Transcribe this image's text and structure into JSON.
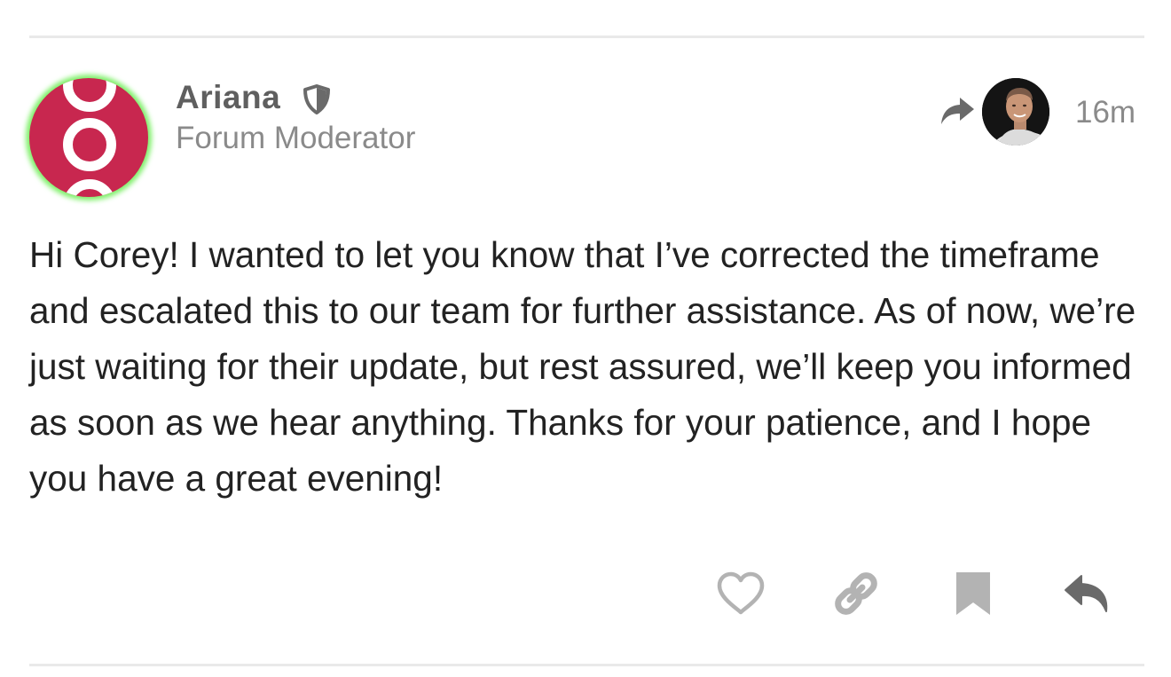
{
  "post": {
    "author": {
      "username": "Ariana",
      "title": "Forum Moderator",
      "avatar_icon": "avatar-rings-icon",
      "avatar_color": "#c8274f",
      "presence_color": "#7ff06a",
      "badge_icon": "shield-icon"
    },
    "reply_to": {
      "icon": "share-arrow-icon",
      "avatar_icon": "user-photo-avatar"
    },
    "time": "16m",
    "body": "Hi Corey! I wanted to let you know that I’ve corrected the timeframe and escalated this to our team for further assistance. As of now, we’re just waiting for their update, but rest assured, we’ll keep you informed as soon as we hear anything. Thanks for your patience, and I hope you have a great evening!",
    "actions": [
      {
        "name": "like",
        "icon": "heart-icon"
      },
      {
        "name": "copy-link",
        "icon": "link-icon"
      },
      {
        "name": "bookmark",
        "icon": "bookmark-icon"
      },
      {
        "name": "reply",
        "icon": "reply-icon"
      }
    ]
  },
  "colors": {
    "text": "#222222",
    "muted": "#8a8a8a",
    "icon_muted": "#b3b3b3",
    "icon_dark": "#6a6a6a",
    "divider": "#e9e9e9"
  }
}
